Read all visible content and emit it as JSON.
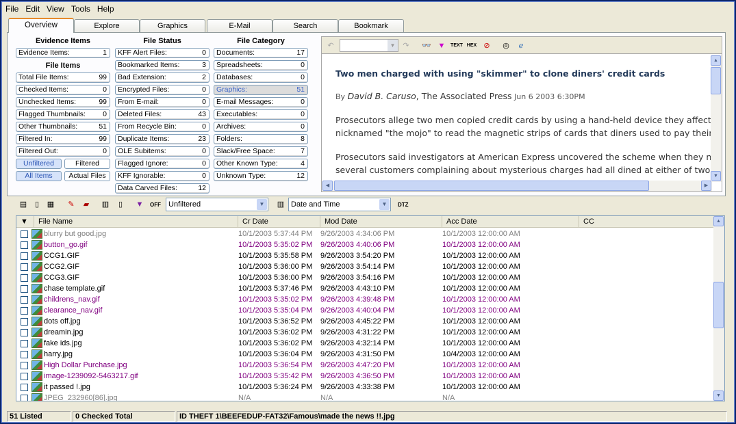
{
  "menu": [
    "File",
    "Edit",
    "View",
    "Tools",
    "Help"
  ],
  "tabs": [
    "Overview",
    "Explore",
    "Graphics",
    "E-Mail",
    "Search",
    "Bookmark"
  ],
  "overview": {
    "evidence_header": "Evidence Items",
    "file_items_header": "File Items",
    "file_status_header": "File Status",
    "file_category_header": "File Category",
    "evidence": [
      {
        "label": "Evidence Items:",
        "value": "1"
      }
    ],
    "file_items": [
      {
        "label": "Total File Items:",
        "value": "99"
      },
      {
        "label": "Checked Items:",
        "value": "0"
      },
      {
        "label": "Unchecked Items:",
        "value": "99"
      },
      {
        "label": "Flagged Thumbnails:",
        "value": "0"
      },
      {
        "label": "Other Thumbnails:",
        "value": "51"
      },
      {
        "label": "Filtered In:",
        "value": "99"
      },
      {
        "label": "Filtered Out:",
        "value": "0"
      }
    ],
    "buttons": {
      "unfiltered": "Unfiltered",
      "filtered": "Filtered",
      "all_items": "All Items",
      "actual_files": "Actual Files"
    },
    "file_status": [
      {
        "label": "KFF Alert Files:",
        "value": "0"
      },
      {
        "label": "Bookmarked Items:",
        "value": "3"
      },
      {
        "label": "Bad Extension:",
        "value": "2"
      },
      {
        "label": "Encrypted Files:",
        "value": "0"
      },
      {
        "label": "From E-mail:",
        "value": "0"
      },
      {
        "label": "Deleted Files:",
        "value": "43"
      },
      {
        "label": "From Recycle Bin:",
        "value": "0"
      },
      {
        "label": "Duplicate Items:",
        "value": "23"
      },
      {
        "label": "OLE Subitems:",
        "value": "0"
      },
      {
        "label": "Flagged Ignore:",
        "value": "0"
      },
      {
        "label": "KFF Ignorable:",
        "value": "0"
      },
      {
        "label": "Data Carved Files:",
        "value": "12"
      }
    ],
    "file_category": [
      {
        "label": "Documents:",
        "value": "17"
      },
      {
        "label": "Spreadsheets:",
        "value": "0"
      },
      {
        "label": "Databases:",
        "value": "0"
      },
      {
        "label": "Graphics:",
        "value": "51"
      },
      {
        "label": "E-mail Messages:",
        "value": "0"
      },
      {
        "label": "Executables:",
        "value": "0"
      },
      {
        "label": "Archives:",
        "value": "0"
      },
      {
        "label": "Folders:",
        "value": "8"
      },
      {
        "label": "Slack/Free Space:",
        "value": "7"
      },
      {
        "label": "Other Known Type:",
        "value": "4"
      },
      {
        "label": "Unknown Type:",
        "value": "12"
      }
    ]
  },
  "preview": {
    "title": "Two men charged with using \"skimmer\" to clone diners' credit cards",
    "by": "By",
    "author": "David B. Caruso",
    "org": ", The Associated Press",
    "date": "Jun 6 2003 6:30PM",
    "p1_l1": "Prosecutors allege two men copied credit cards by using a hand-held device they affectio",
    "p1_l2": "nicknamed \"the mojo\" to read the magnetic strips of cards that diners used to pay their",
    "p2_l1": "Prosecutors said investigators at American Express uncovered the scheme when they no",
    "p2_l2": "several customers complaining about mysterious charges had all dined at either of two P"
  },
  "list_toolbar": {
    "filter_off": "OFF",
    "filter_value": "Unfiltered",
    "date_value": "Date and Time",
    "dtz": "DTZ"
  },
  "columns": [
    "File Name",
    "Cr Date",
    "Mod Date",
    "Acc Date",
    "CC"
  ],
  "files": [
    {
      "name": "blurry but good.jpg",
      "cr": "10/1/2003 5:37:44 PM",
      "mod": "9/26/2003 4:34:06 PM",
      "acc": "10/1/2003 12:00:00 AM",
      "color": "gray"
    },
    {
      "name": "button_go.gif",
      "cr": "10/1/2003 5:35:02 PM",
      "mod": "9/26/2003 4:40:06 PM",
      "acc": "10/1/2003 12:00:00 AM",
      "color": "purple"
    },
    {
      "name": "CCG1.GIF",
      "cr": "10/1/2003 5:35:58 PM",
      "mod": "9/26/2003 3:54:20 PM",
      "acc": "10/1/2003 12:00:00 AM",
      "color": "black"
    },
    {
      "name": "CCG2.GIF",
      "cr": "10/1/2003 5:36:00 PM",
      "mod": "9/26/2003 3:54:14 PM",
      "acc": "10/1/2003 12:00:00 AM",
      "color": "black"
    },
    {
      "name": "CCG3.GIF",
      "cr": "10/1/2003 5:36:00 PM",
      "mod": "9/26/2003 3:54:16 PM",
      "acc": "10/1/2003 12:00:00 AM",
      "color": "black"
    },
    {
      "name": "chase template.gif",
      "cr": "10/1/2003 5:37:46 PM",
      "mod": "9/26/2003 4:43:10 PM",
      "acc": "10/1/2003 12:00:00 AM",
      "color": "black"
    },
    {
      "name": "childrens_nav.gif",
      "cr": "10/1/2003 5:35:02 PM",
      "mod": "9/26/2003 4:39:48 PM",
      "acc": "10/1/2003 12:00:00 AM",
      "color": "purple"
    },
    {
      "name": "clearance_nav.gif",
      "cr": "10/1/2003 5:35:04 PM",
      "mod": "9/26/2003 4:40:04 PM",
      "acc": "10/1/2003 12:00:00 AM",
      "color": "purple"
    },
    {
      "name": "dots off.jpg",
      "cr": "10/1/2003 5:36:52 PM",
      "mod": "9/26/2003 4:45:22 PM",
      "acc": "10/1/2003 12:00:00 AM",
      "color": "black"
    },
    {
      "name": "dreamin.jpg",
      "cr": "10/1/2003 5:36:02 PM",
      "mod": "9/26/2003 4:31:22 PM",
      "acc": "10/1/2003 12:00:00 AM",
      "color": "black"
    },
    {
      "name": "fake ids.jpg",
      "cr": "10/1/2003 5:36:02 PM",
      "mod": "9/26/2003 4:32:14 PM",
      "acc": "10/1/2003 12:00:00 AM",
      "color": "black"
    },
    {
      "name": "harry.jpg",
      "cr": "10/1/2003 5:36:04 PM",
      "mod": "9/26/2003 4:31:50 PM",
      "acc": "10/4/2003 12:00:00 AM",
      "color": "black"
    },
    {
      "name": "High Dollar Purchase.jpg",
      "cr": "10/1/2003 5:36:54 PM",
      "mod": "9/26/2003 4:47:20 PM",
      "acc": "10/1/2003 12:00:00 AM",
      "color": "purple"
    },
    {
      "name": "image-1239092-5463217.gif",
      "cr": "10/1/2003 5:35:42 PM",
      "mod": "9/26/2003 4:36:50 PM",
      "acc": "10/1/2003 12:00:00 AM",
      "color": "purple"
    },
    {
      "name": "it passed !.jpg",
      "cr": "10/1/2003 5:36:24 PM",
      "mod": "9/26/2003 4:33:38 PM",
      "acc": "10/1/2003 12:00:00 AM",
      "color": "black"
    },
    {
      "name": "JPEG_232960[86].jpg",
      "cr": "N/A",
      "mod": "N/A",
      "acc": "N/A",
      "color": "gray"
    }
  ],
  "status": {
    "listed": "51 Listed",
    "checked": "0 Checked Total",
    "path": "ID THEFT 1\\BEEFEDUP-FAT32\\Famous\\made the news !!.jpg"
  },
  "colors": {
    "accent_tab": "#e68b2c",
    "highlight_text": "#3a63c8",
    "deleted_purple": "#800080",
    "inactive_gray": "#808080"
  }
}
